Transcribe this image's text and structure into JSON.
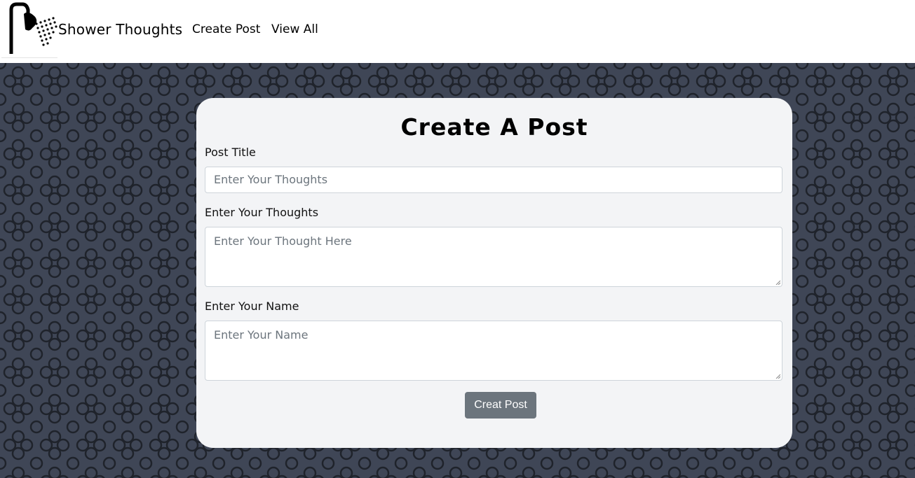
{
  "navbar": {
    "brand": "Shower Thoughts",
    "links": [
      {
        "label": "Create Post"
      },
      {
        "label": "View All"
      }
    ],
    "logo_icon": "shower-head-icon"
  },
  "form": {
    "title": "Create A Post",
    "post_title": {
      "label": "Post Title",
      "placeholder": "Enter Your Thoughts"
    },
    "thoughts": {
      "label": "Enter Your Thoughts",
      "placeholder": "Enter Your Thought Here"
    },
    "name": {
      "label": "Enter Your Name",
      "placeholder": "Enter Your Name"
    },
    "submit_label": "Creat Post"
  },
  "colors": {
    "background": "#3f4656",
    "pattern": "#1f232b",
    "card": "#f3f4f6",
    "button": "#6c757d"
  }
}
